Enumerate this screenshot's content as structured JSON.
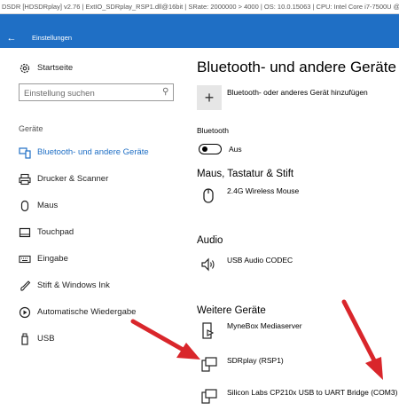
{
  "hdsdr_bar": {
    "text": "DSDR [HDSDRplay] v2.76  |  ExtIO_SDRplay_RSP1.dll@16bit  |  SRate: 2000000 > 4000  |  OS: 10.0.15063  |  CPU: Intel Core i7-7500U @ 2.7"
  },
  "window": {
    "back_icon": "←",
    "title": "Einstellungen"
  },
  "sidebar": {
    "home": {
      "label": "Startseite",
      "icon": "gear-icon"
    },
    "search": {
      "placeholder": "Einstellung suchen",
      "icon": "search-icon"
    },
    "section": "Geräte",
    "items": [
      {
        "label": "Bluetooth- und andere Geräte",
        "icon": "devices-icon",
        "active": true
      },
      {
        "label": "Drucker & Scanner",
        "icon": "printer-icon",
        "active": false
      },
      {
        "label": "Maus",
        "icon": "mouse-icon",
        "active": false
      },
      {
        "label": "Touchpad",
        "icon": "touchpad-icon",
        "active": false
      },
      {
        "label": "Eingabe",
        "icon": "keyboard-icon",
        "active": false
      },
      {
        "label": "Stift & Windows Ink",
        "icon": "pen-icon",
        "active": false
      },
      {
        "label": "Automatische Wiedergabe",
        "icon": "autoplay-icon",
        "active": false
      },
      {
        "label": "USB",
        "icon": "usb-icon",
        "active": false
      }
    ]
  },
  "main": {
    "title": "Bluetooth- und andere Geräte",
    "add_device": {
      "symbol": "+",
      "label": "Bluetooth- oder anderes Gerät hinzufügen"
    },
    "bluetooth": {
      "label": "Bluetooth",
      "state": "Aus",
      "on": false
    },
    "sections": {
      "mouse": {
        "heading": "Maus, Tastatur & Stift",
        "devices": [
          {
            "name": "2.4G Wireless Mouse",
            "icon": "mouse-icon"
          }
        ]
      },
      "audio": {
        "heading": "Audio",
        "devices": [
          {
            "name": "USB Audio CODEC",
            "icon": "speaker-icon"
          }
        ]
      },
      "other": {
        "heading": "Weitere Geräte",
        "devices": [
          {
            "name": "MyneBox Mediaserver",
            "icon": "media-server-icon"
          },
          {
            "name": "SDRplay (RSP1)",
            "icon": "device-icon"
          },
          {
            "name": "Silicon Labs CP210x USB to UART Bridge (COM3)",
            "icon": "device-icon"
          }
        ]
      }
    }
  },
  "colors": {
    "accent": "#1f6fc5",
    "arrow": "#d9262b"
  }
}
